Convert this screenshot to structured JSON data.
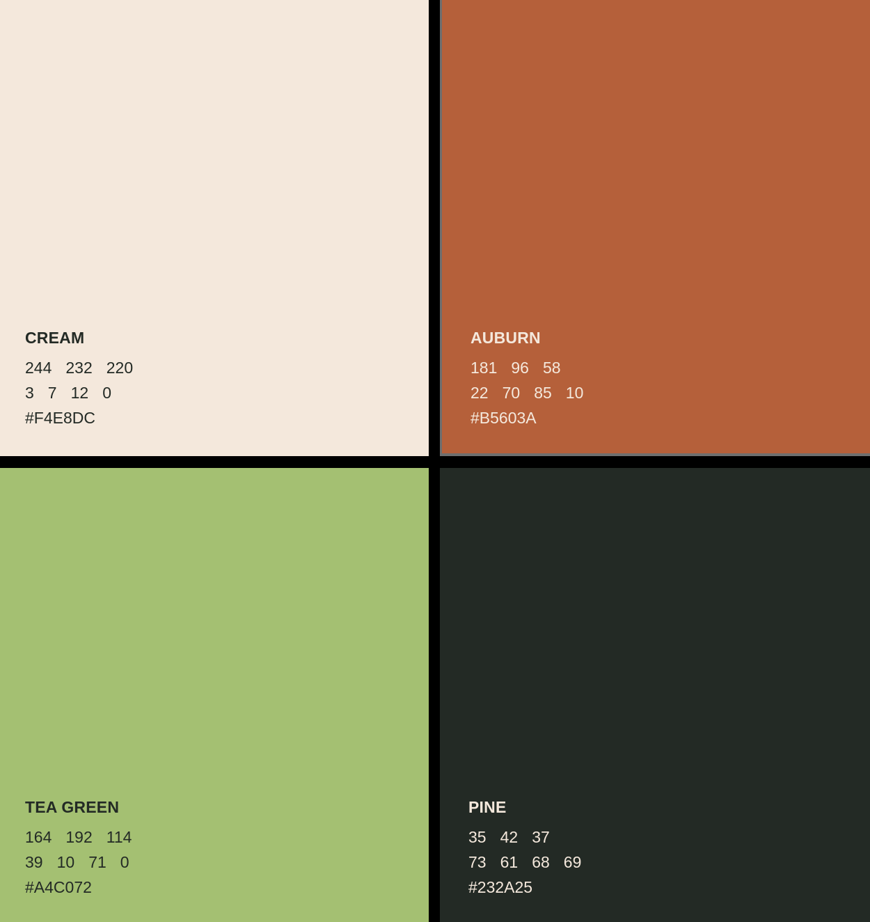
{
  "colors": [
    {
      "name": "CREAM",
      "rgb": [
        "244",
        "232",
        "220"
      ],
      "cmyk": [
        "3",
        "7",
        "12",
        "0"
      ],
      "hex": "#F4E8DC",
      "bg": "#F4E8DC",
      "text_color": "#232A25"
    },
    {
      "name": "AUBURN",
      "rgb": [
        "181",
        "96",
        "58"
      ],
      "cmyk": [
        "22",
        "70",
        "85",
        "10"
      ],
      "hex": "#B5603A",
      "bg": "#B5603A",
      "text_color": "#F4E8DC"
    },
    {
      "name": "TEA GREEN",
      "rgb": [
        "164",
        "192",
        "114"
      ],
      "cmyk": [
        "39",
        "10",
        "71",
        "0"
      ],
      "hex": "#A4C072",
      "bg": "#A4C072",
      "text_color": "#232A25"
    },
    {
      "name": "PINE",
      "rgb": [
        "35",
        "42",
        "37"
      ],
      "cmyk": [
        "73",
        "61",
        "68",
        "69"
      ],
      "hex": "#232A25",
      "bg": "#232A25",
      "text_color": "#F4E8DC"
    }
  ]
}
